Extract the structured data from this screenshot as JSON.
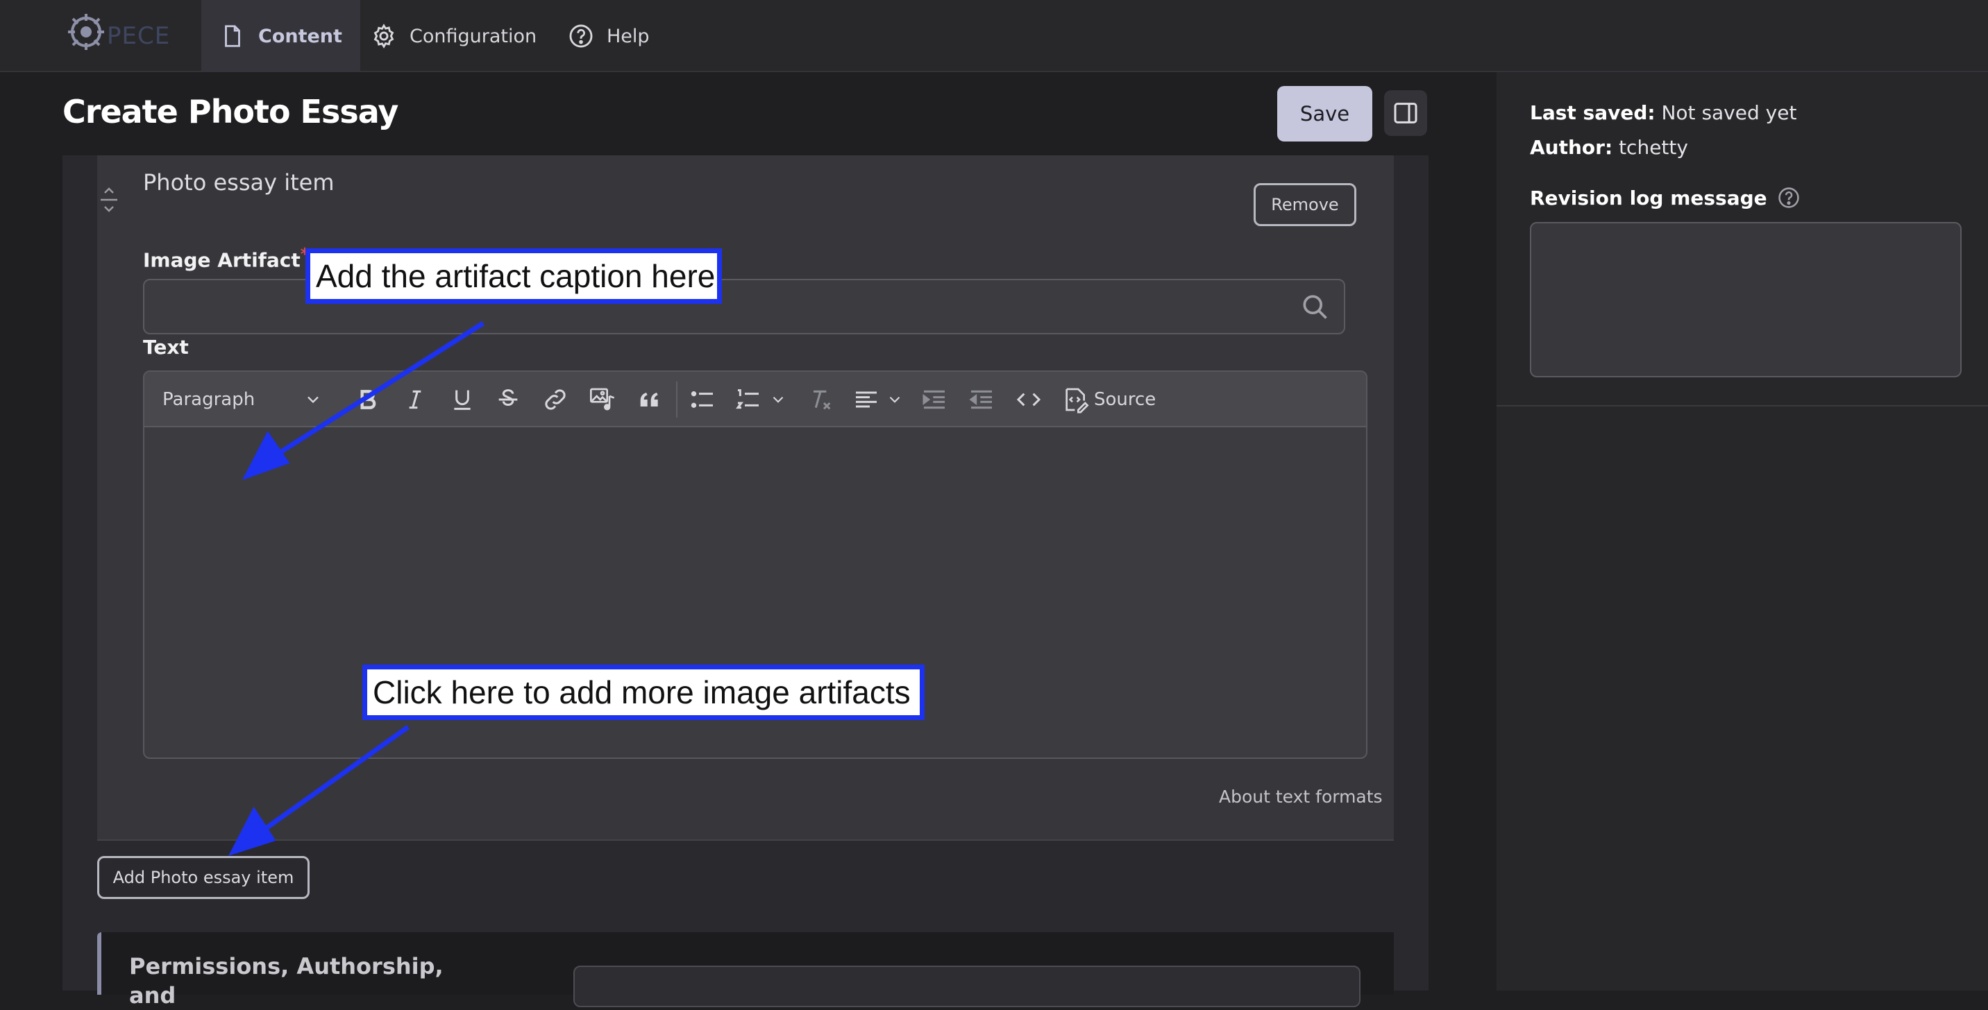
{
  "toolbar": {
    "logo_text": "PECE",
    "tabs": [
      {
        "label": "Content",
        "icon": "document-icon",
        "active": true
      },
      {
        "label": "Configuration",
        "icon": "gear-icon",
        "active": false
      },
      {
        "label": "Help",
        "icon": "help-circle-icon",
        "active": false
      }
    ]
  },
  "page": {
    "title": "Create Photo Essay",
    "save_label": "Save"
  },
  "item": {
    "title": "Photo essay item",
    "remove_label": "Remove",
    "image_label": "Image Artifact",
    "required_mark": "*",
    "image_value": "",
    "text_label": "Text"
  },
  "editor": {
    "format_select": "Paragraph",
    "source_label": "Source",
    "buttons": [
      "bold-icon",
      "italic-icon",
      "underline-icon",
      "strikethrough-icon",
      "link-icon",
      "image-audio-icon",
      "blockquote-icon",
      "bulleted-list-icon",
      "numbered-list-icon",
      "remove-format-icon",
      "align-icon",
      "indent-icon",
      "outdent-icon",
      "code-icon",
      "source-icon"
    ],
    "content": ""
  },
  "about_formats": "About text formats",
  "add_item_label": "Add Photo essay item",
  "details_title": "Permissions, Authorship, and",
  "sidebar": {
    "last_saved_label": "Last saved:",
    "last_saved_value": "Not saved yet",
    "author_label": "Author:",
    "author_value": "tchetty",
    "revision_label": "Revision log message",
    "revision_value": ""
  },
  "annotations": {
    "caption_callout": "Add the artifact caption here",
    "add_callout": "Click here to add more image artifacts",
    "color": "#1c32f0"
  },
  "colors": {
    "accent": "#c6c7dc",
    "required": "#e0494c",
    "background": "#1f1f22"
  }
}
